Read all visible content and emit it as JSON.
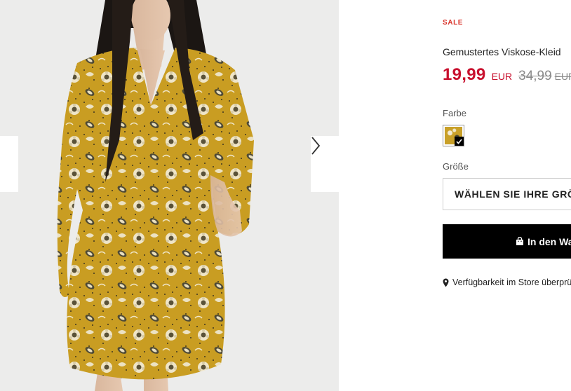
{
  "gallery": {
    "image_alt": "Model wearing a yellow floral printed viscose dress",
    "prev_icon": "chevron-left-icon",
    "next_icon": "chevron-right-icon"
  },
  "product": {
    "badge": "SALE",
    "title": "Gemustertes Viskose-Kleid",
    "price_current": "19,99",
    "currency_current": "EUR",
    "price_original": "34,99",
    "currency_original": "EUR",
    "price_color": "#c8102e"
  },
  "color": {
    "label": "Farbe",
    "selected_swatch": "yellow-floral",
    "check_icon": "checkmark-icon"
  },
  "size": {
    "label": "Größe",
    "placeholder": "WÄHLEN SIE IHRE GRÖSSE"
  },
  "cart": {
    "label": "In den Warenkorb",
    "icon": "shopping-bag-icon"
  },
  "store": {
    "label": "Verfügbarkeit im Store überprüfen",
    "icon": "map-pin-icon"
  }
}
